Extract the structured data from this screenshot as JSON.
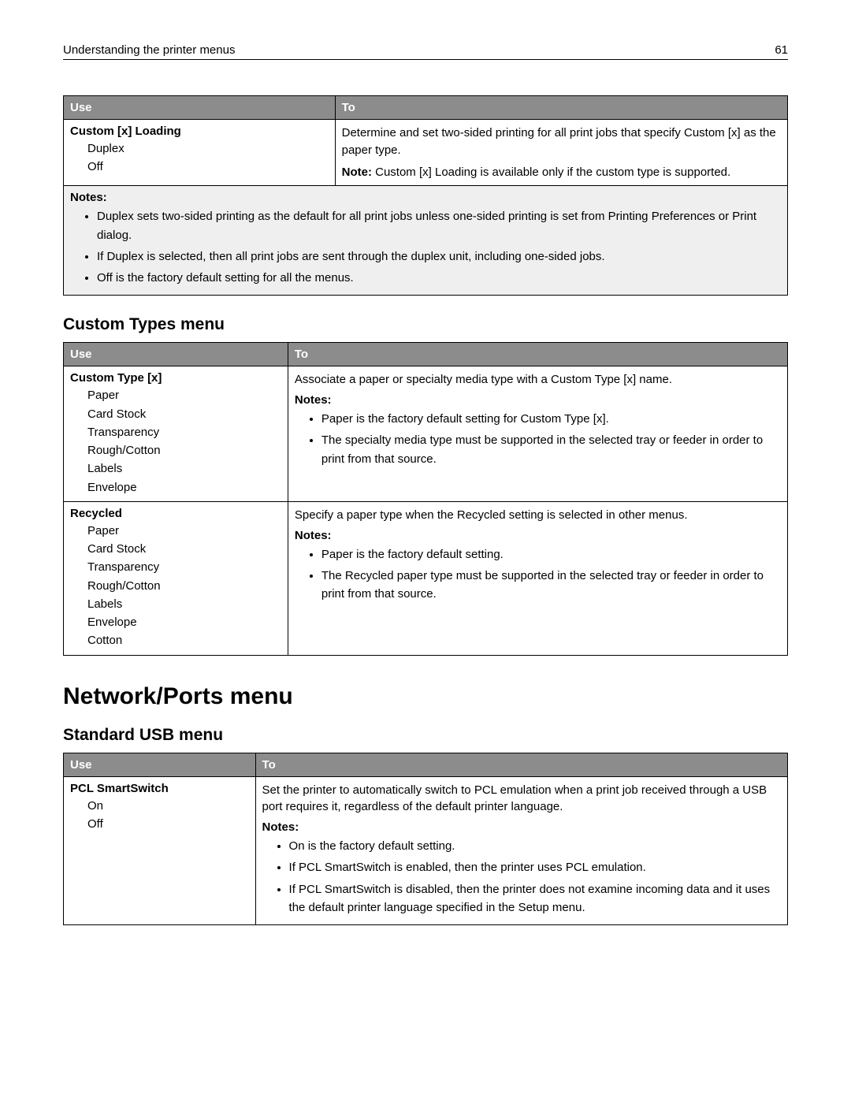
{
  "header": {
    "title": "Understanding the printer menus",
    "page_number": "61"
  },
  "table1": {
    "col_use": "Use",
    "col_to": "To",
    "row1": {
      "title": "Custom [x] Loading",
      "opts": [
        "Duplex",
        "Off"
      ],
      "desc": "Determine and set two‑sided printing for all print jobs that specify Custom [x] as the paper type.",
      "note_prefix": "Note:",
      "note_body": " Custom [x] Loading is available only if the custom type is supported."
    },
    "notes_heading": "Notes:",
    "notes": [
      "Duplex sets two‑sided printing as the default for all print jobs unless one‑sided printing is set from Printing Preferences or Print dialog.",
      "If Duplex is selected, then all print jobs are sent through the duplex unit, including one‑sided jobs.",
      "Off is the factory default setting for all the menus."
    ]
  },
  "custom_types_heading": "Custom Types menu",
  "table2": {
    "col_use": "Use",
    "col_to": "To",
    "row1": {
      "title": "Custom Type [x]",
      "opts": [
        "Paper",
        "Card Stock",
        "Transparency",
        "Rough/Cotton",
        "Labels",
        "Envelope"
      ],
      "desc": "Associate a paper or specialty media type with a Custom Type [x] name.",
      "notes_heading": "Notes:",
      "notes": [
        "Paper is the factory default setting for Custom Type [x].",
        "The specialty media type must be supported in the selected tray or feeder in order to print from that source."
      ]
    },
    "row2": {
      "title": "Recycled",
      "opts": [
        "Paper",
        "Card Stock",
        "Transparency",
        "Rough/Cotton",
        "Labels",
        "Envelope",
        "Cotton"
      ],
      "desc": "Specify a paper type when the Recycled setting is selected in other menus.",
      "notes_heading": "Notes:",
      "notes": [
        "Paper is the factory default setting.",
        "The Recycled paper type must be supported in the selected tray or feeder in order to print from that source."
      ]
    }
  },
  "network_heading": "Network/Ports menu",
  "usb_heading": "Standard USB menu",
  "table3": {
    "col_use": "Use",
    "col_to": "To",
    "row1": {
      "title": "PCL SmartSwitch",
      "opts": [
        "On",
        "Off"
      ],
      "desc": "Set the printer to automatically switch to PCL emulation when a print job received through a USB port requires it, regardless of the default printer language.",
      "notes_heading": "Notes:",
      "notes": [
        "On is the factory default setting.",
        "If PCL SmartSwitch is enabled, then the printer uses PCL emulation.",
        "If PCL SmartSwitch is disabled, then the printer does not examine incoming data and it uses the default printer language specified in the Setup menu."
      ]
    }
  }
}
